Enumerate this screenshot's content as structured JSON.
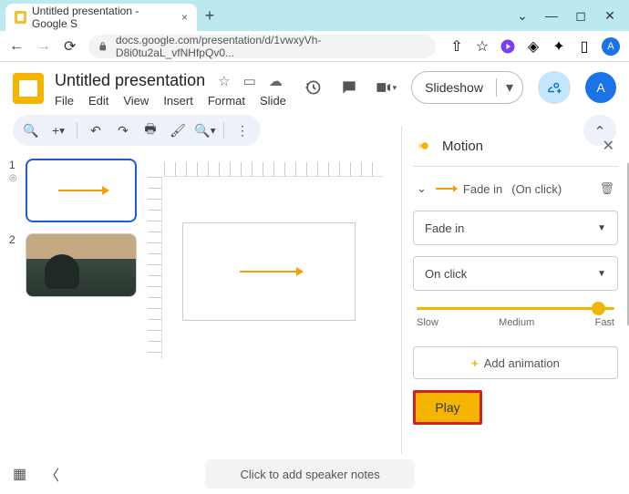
{
  "browser": {
    "tab_title": "Untitled presentation - Google S",
    "url": "docs.google.com/presentation/d/1vwxyVh-D8i0tu2aL_vfNHfpQv0...",
    "avatar_letter": "A"
  },
  "header": {
    "doc_title": "Untitled presentation",
    "menus": [
      "File",
      "Edit",
      "View",
      "Insert",
      "Format",
      "Slide"
    ],
    "slideshow_label": "Slideshow",
    "avatar_letter": "A"
  },
  "thumbs": [
    {
      "num": "1",
      "type": "arrow",
      "active": true
    },
    {
      "num": "2",
      "type": "photo",
      "active": false
    }
  ],
  "motion": {
    "title": "Motion",
    "anim_name": "Fade in",
    "anim_trigger": "(On click)",
    "effect_select": "Fade in",
    "trigger_select": "On click",
    "speed": {
      "slow": "Slow",
      "medium": "Medium",
      "fast": "Fast"
    },
    "add_label": "Add animation",
    "play_label": "Play"
  },
  "footer": {
    "notes_placeholder": "Click to add speaker notes"
  }
}
